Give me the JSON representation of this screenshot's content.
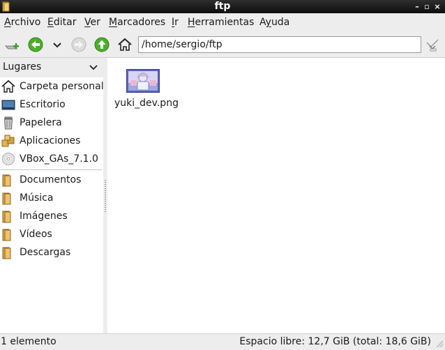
{
  "window": {
    "title": "ftp",
    "buttons": {
      "minimize": "–",
      "maximize": "▫",
      "close": "×"
    }
  },
  "menubar": {
    "items": [
      {
        "label": "Archivo",
        "accel": "A",
        "rest": "rchivo"
      },
      {
        "label": "Editar",
        "accel": "E",
        "rest": "ditar"
      },
      {
        "label": "Ver",
        "accel": "V",
        "rest": "er"
      },
      {
        "label": "Marcadores",
        "accel": "M",
        "rest": "arcadores"
      },
      {
        "label": "Ir",
        "accel": "I",
        "rest": "r"
      },
      {
        "label": "Herramientas",
        "accel": "H",
        "rest": "erramientas"
      },
      {
        "label": "Ayuda",
        "accel": "y",
        "pre": "A",
        "rest": "uda"
      }
    ]
  },
  "toolbar": {
    "location": "/home/sergio/ftp",
    "icons": [
      "new-tab-icon",
      "back-arrow-icon",
      "history-dropdown-icon",
      "forward-arrow-icon",
      "up-arrow-icon",
      "home-icon",
      "location-toggle-icon"
    ]
  },
  "sidebar": {
    "header": "Lugares",
    "places": [
      {
        "label": "Carpeta personal",
        "icon": "home-folder-icon"
      },
      {
        "label": "Escritorio",
        "icon": "desktop-icon"
      },
      {
        "label": "Papelera",
        "icon": "trash-icon"
      },
      {
        "label": "Aplicaciones",
        "icon": "applications-icon"
      },
      {
        "label": "VBox_GAs_7.1.0",
        "icon": "optical-disc-icon"
      }
    ],
    "bookmarks": [
      {
        "label": "Documentos",
        "icon": "folder-icon"
      },
      {
        "label": "Música",
        "icon": "folder-icon"
      },
      {
        "label": "Imágenes",
        "icon": "folder-icon"
      },
      {
        "label": "Vídeos",
        "icon": "folder-icon"
      },
      {
        "label": "Descargas",
        "icon": "folder-icon"
      }
    ]
  },
  "content": {
    "files": [
      {
        "name": "yuki_dev.png",
        "icon": "image-thumbnail-icon"
      }
    ]
  },
  "statusbar": {
    "left": "1 elemento",
    "right": "Espacio libre: 12,7 GiB (total: 18,6 GiB)"
  },
  "colors": {
    "chrome": "#ededed",
    "titlebar": "#1e1e1e",
    "green_nav": "#4caf2a",
    "folder": "#e2b457"
  }
}
